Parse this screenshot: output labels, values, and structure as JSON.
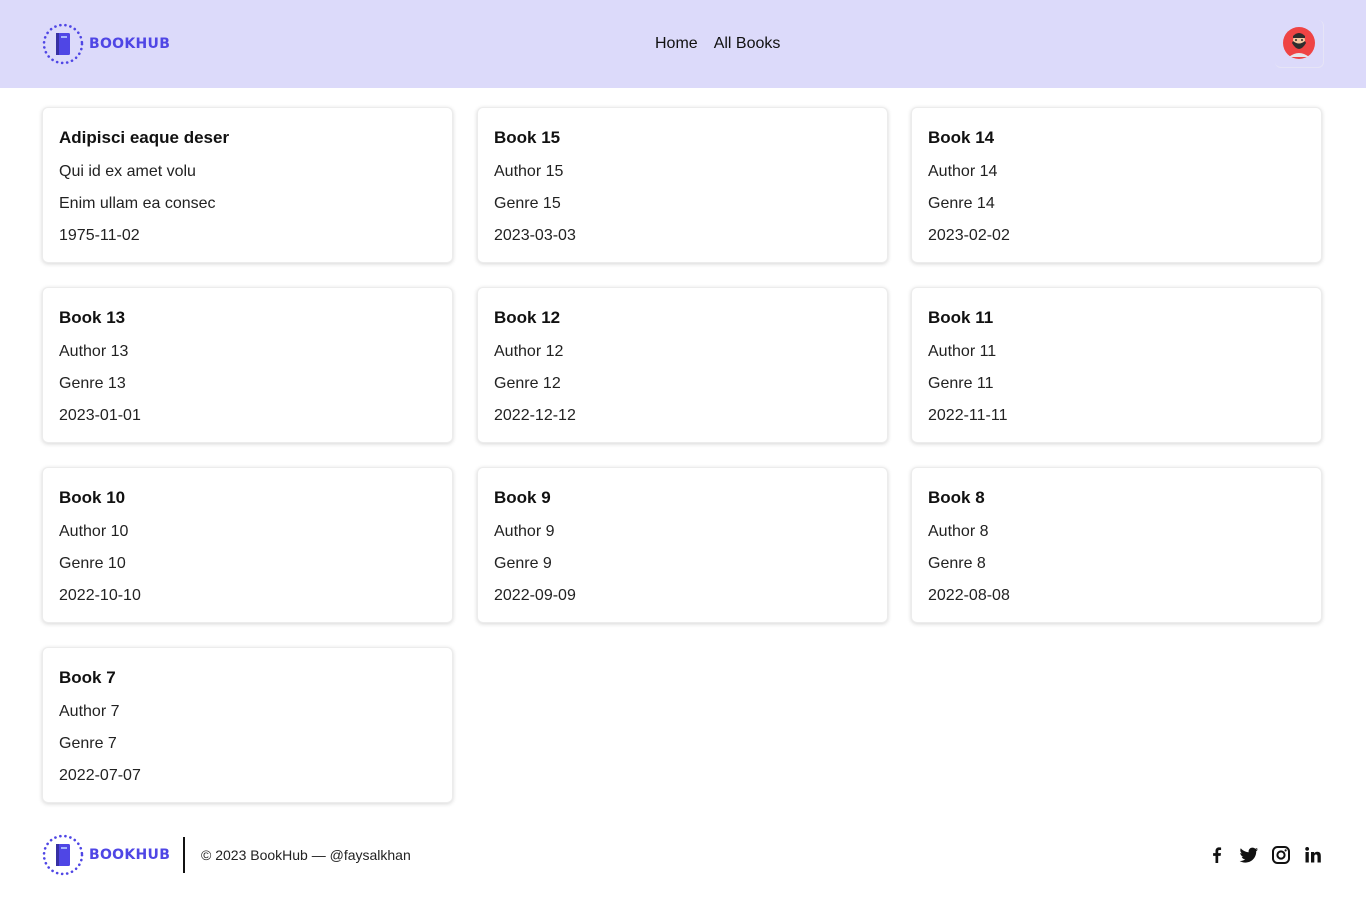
{
  "brand": {
    "name": "BOOKHUB",
    "accent_color": "#4f46e5",
    "logo_icon": "book-icon"
  },
  "header": {
    "background": "#dcdafa",
    "nav": [
      {
        "label": "Home"
      },
      {
        "label": "All Books"
      }
    ],
    "avatar_icon": "user-avatar-icon"
  },
  "books": [
    {
      "title": "Adipisci eaque deser",
      "author": "Qui id ex amet volu",
      "genre": "Enim ullam ea consec",
      "date": "1975-11-02"
    },
    {
      "title": "Book 15",
      "author": "Author 15",
      "genre": "Genre 15",
      "date": "2023-03-03"
    },
    {
      "title": "Book 14",
      "author": "Author 14",
      "genre": "Genre 14",
      "date": "2023-02-02"
    },
    {
      "title": "Book 13",
      "author": "Author 13",
      "genre": "Genre 13",
      "date": "2023-01-01"
    },
    {
      "title": "Book 12",
      "author": "Author 12",
      "genre": "Genre 12",
      "date": "2022-12-12"
    },
    {
      "title": "Book 11",
      "author": "Author 11",
      "genre": "Genre 11",
      "date": "2022-11-11"
    },
    {
      "title": "Book 10",
      "author": "Author 10",
      "genre": "Genre 10",
      "date": "2022-10-10"
    },
    {
      "title": "Book 9",
      "author": "Author 9",
      "genre": "Genre 9",
      "date": "2022-09-09"
    },
    {
      "title": "Book 8",
      "author": "Author 8",
      "genre": "Genre 8",
      "date": "2022-08-08"
    },
    {
      "title": "Book 7",
      "author": "Author 7",
      "genre": "Genre 7",
      "date": "2022-07-07"
    }
  ],
  "footer": {
    "copyright": "© 2023 BookHub — @faysalkhan",
    "socials": [
      "facebook-icon",
      "twitter-icon",
      "instagram-icon",
      "linkedin-icon"
    ]
  }
}
